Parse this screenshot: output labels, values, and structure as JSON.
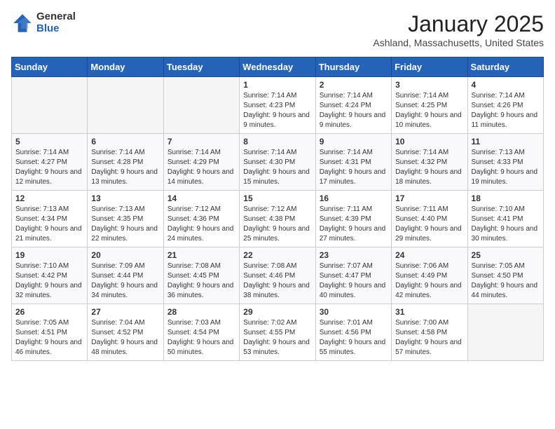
{
  "logo": {
    "general": "General",
    "blue": "Blue"
  },
  "title": "January 2025",
  "subtitle": "Ashland, Massachusetts, United States",
  "days_of_week": [
    "Sunday",
    "Monday",
    "Tuesday",
    "Wednesday",
    "Thursday",
    "Friday",
    "Saturday"
  ],
  "weeks": [
    [
      {
        "day": "",
        "info": ""
      },
      {
        "day": "",
        "info": ""
      },
      {
        "day": "",
        "info": ""
      },
      {
        "day": "1",
        "info": "Sunrise: 7:14 AM\nSunset: 4:23 PM\nDaylight: 9 hours and 9 minutes."
      },
      {
        "day": "2",
        "info": "Sunrise: 7:14 AM\nSunset: 4:24 PM\nDaylight: 9 hours and 9 minutes."
      },
      {
        "day": "3",
        "info": "Sunrise: 7:14 AM\nSunset: 4:25 PM\nDaylight: 9 hours and 10 minutes."
      },
      {
        "day": "4",
        "info": "Sunrise: 7:14 AM\nSunset: 4:26 PM\nDaylight: 9 hours and 11 minutes."
      }
    ],
    [
      {
        "day": "5",
        "info": "Sunrise: 7:14 AM\nSunset: 4:27 PM\nDaylight: 9 hours and 12 minutes."
      },
      {
        "day": "6",
        "info": "Sunrise: 7:14 AM\nSunset: 4:28 PM\nDaylight: 9 hours and 13 minutes."
      },
      {
        "day": "7",
        "info": "Sunrise: 7:14 AM\nSunset: 4:29 PM\nDaylight: 9 hours and 14 minutes."
      },
      {
        "day": "8",
        "info": "Sunrise: 7:14 AM\nSunset: 4:30 PM\nDaylight: 9 hours and 15 minutes."
      },
      {
        "day": "9",
        "info": "Sunrise: 7:14 AM\nSunset: 4:31 PM\nDaylight: 9 hours and 17 minutes."
      },
      {
        "day": "10",
        "info": "Sunrise: 7:14 AM\nSunset: 4:32 PM\nDaylight: 9 hours and 18 minutes."
      },
      {
        "day": "11",
        "info": "Sunrise: 7:13 AM\nSunset: 4:33 PM\nDaylight: 9 hours and 19 minutes."
      }
    ],
    [
      {
        "day": "12",
        "info": "Sunrise: 7:13 AM\nSunset: 4:34 PM\nDaylight: 9 hours and 21 minutes."
      },
      {
        "day": "13",
        "info": "Sunrise: 7:13 AM\nSunset: 4:35 PM\nDaylight: 9 hours and 22 minutes."
      },
      {
        "day": "14",
        "info": "Sunrise: 7:12 AM\nSunset: 4:36 PM\nDaylight: 9 hours and 24 minutes."
      },
      {
        "day": "15",
        "info": "Sunrise: 7:12 AM\nSunset: 4:38 PM\nDaylight: 9 hours and 25 minutes."
      },
      {
        "day": "16",
        "info": "Sunrise: 7:11 AM\nSunset: 4:39 PM\nDaylight: 9 hours and 27 minutes."
      },
      {
        "day": "17",
        "info": "Sunrise: 7:11 AM\nSunset: 4:40 PM\nDaylight: 9 hours and 29 minutes."
      },
      {
        "day": "18",
        "info": "Sunrise: 7:10 AM\nSunset: 4:41 PM\nDaylight: 9 hours and 30 minutes."
      }
    ],
    [
      {
        "day": "19",
        "info": "Sunrise: 7:10 AM\nSunset: 4:42 PM\nDaylight: 9 hours and 32 minutes."
      },
      {
        "day": "20",
        "info": "Sunrise: 7:09 AM\nSunset: 4:44 PM\nDaylight: 9 hours and 34 minutes."
      },
      {
        "day": "21",
        "info": "Sunrise: 7:08 AM\nSunset: 4:45 PM\nDaylight: 9 hours and 36 minutes."
      },
      {
        "day": "22",
        "info": "Sunrise: 7:08 AM\nSunset: 4:46 PM\nDaylight: 9 hours and 38 minutes."
      },
      {
        "day": "23",
        "info": "Sunrise: 7:07 AM\nSunset: 4:47 PM\nDaylight: 9 hours and 40 minutes."
      },
      {
        "day": "24",
        "info": "Sunrise: 7:06 AM\nSunset: 4:49 PM\nDaylight: 9 hours and 42 minutes."
      },
      {
        "day": "25",
        "info": "Sunrise: 7:05 AM\nSunset: 4:50 PM\nDaylight: 9 hours and 44 minutes."
      }
    ],
    [
      {
        "day": "26",
        "info": "Sunrise: 7:05 AM\nSunset: 4:51 PM\nDaylight: 9 hours and 46 minutes."
      },
      {
        "day": "27",
        "info": "Sunrise: 7:04 AM\nSunset: 4:52 PM\nDaylight: 9 hours and 48 minutes."
      },
      {
        "day": "28",
        "info": "Sunrise: 7:03 AM\nSunset: 4:54 PM\nDaylight: 9 hours and 50 minutes."
      },
      {
        "day": "29",
        "info": "Sunrise: 7:02 AM\nSunset: 4:55 PM\nDaylight: 9 hours and 53 minutes."
      },
      {
        "day": "30",
        "info": "Sunrise: 7:01 AM\nSunset: 4:56 PM\nDaylight: 9 hours and 55 minutes."
      },
      {
        "day": "31",
        "info": "Sunrise: 7:00 AM\nSunset: 4:58 PM\nDaylight: 9 hours and 57 minutes."
      },
      {
        "day": "",
        "info": ""
      }
    ]
  ]
}
